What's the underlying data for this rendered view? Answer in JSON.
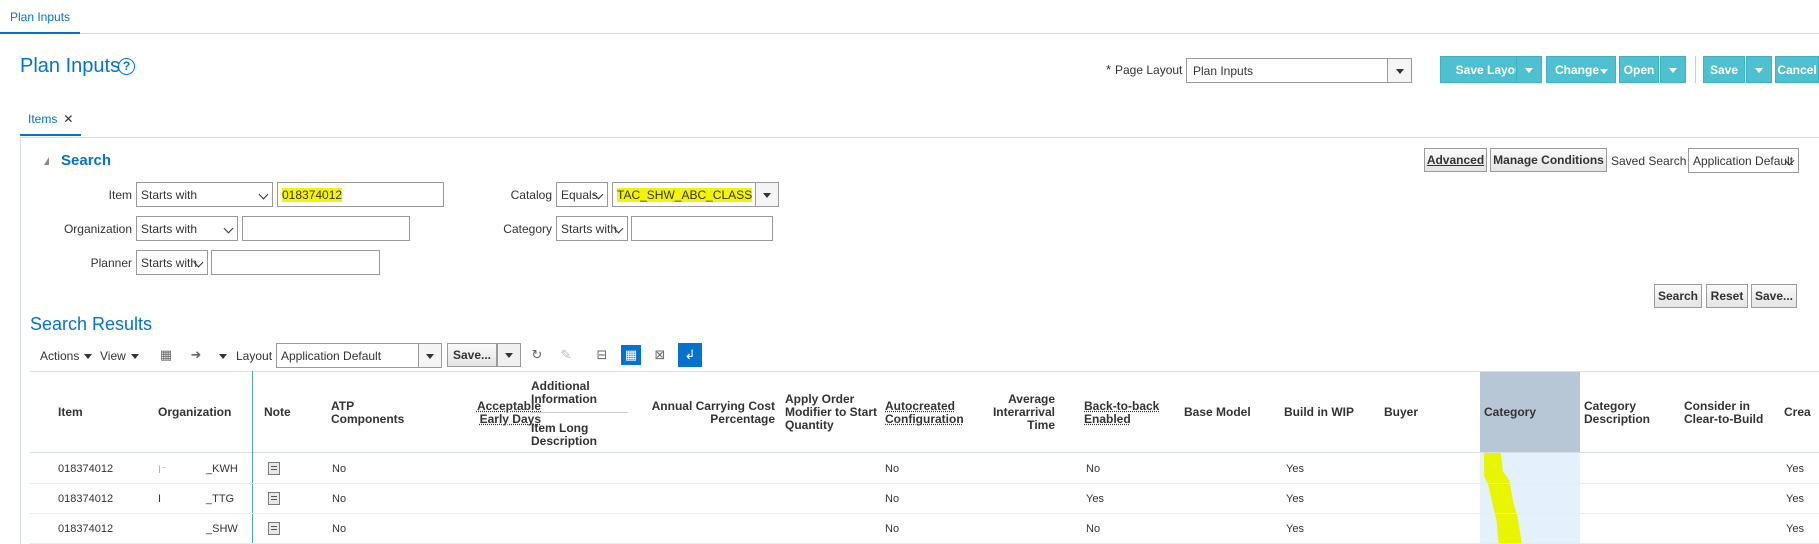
{
  "nav": {
    "tab_label": "Plan Inputs"
  },
  "header": {
    "title": "Plan Inputs",
    "help_icon": "?",
    "page_layout_required": "*",
    "page_layout_label": "Page Layout",
    "page_layout_value": "Plan Inputs",
    "buttons": {
      "save_layout": "Save Layout",
      "change": "Change",
      "open": "Open",
      "save": "Save",
      "cancel": "Cancel"
    }
  },
  "tabs": {
    "items": "Items",
    "close": "✕"
  },
  "search": {
    "heading": "Search",
    "advanced": "Advanced",
    "manage_conditions": "Manage Conditions",
    "saved_search_label": "Saved Search",
    "saved_search_value": "Application Default",
    "item_label": "Item",
    "item_operator": "Starts with",
    "item_value": "018374012",
    "organization_label": "Organization",
    "organization_operator": "Starts with",
    "organization_value": "",
    "planner_label": "Planner",
    "planner_operator": "Starts with",
    "planner_value": "",
    "catalog_label": "Catalog",
    "catalog_operator": "Equals",
    "catalog_value": "TAC_SHW_ABC_CLASS",
    "category_label": "Category",
    "category_operator": "Starts with",
    "category_value": "",
    "search_btn": "Search",
    "reset_btn": "Reset",
    "save_btn": "Save..."
  },
  "results": {
    "heading": "Search Results",
    "actions": "Actions",
    "view": "View",
    "layout_label": "Layout",
    "layout_value": "Application Default",
    "save_btn": "Save..."
  },
  "table": {
    "headers": {
      "item": "Item",
      "organization": "Organization",
      "note": "Note",
      "atp_1": "ATP",
      "atp_2": "Components",
      "acc_1": "Acceptable",
      "acc_2": "Early Days",
      "addl_1": "Additional",
      "addl_2": "Information",
      "ild_1": "Item Long",
      "ild_2": "Description",
      "acc_cost_1": "Annual Carrying Cost",
      "acc_cost_2": "Percentage",
      "aom_1": "Apply Order",
      "aom_2": "Modifier to Start",
      "aom_3": "Quantity",
      "auto_1": "Autocreated",
      "auto_2": "Configuration",
      "ait_1": "Average",
      "ait_2": "Interarrival",
      "ait_3": "Time",
      "b2b_1": "Back-to-back",
      "b2b_2": "Enabled",
      "base_model": "Base Model",
      "build_wip": "Build in WIP",
      "buyer": "Buyer",
      "category": "Category",
      "catdesc_1": "Category",
      "catdesc_2": "Description",
      "ctb_1": "Consider in",
      "ctb_2": "Clear-to-Build",
      "crea": "Crea"
    },
    "rows": [
      {
        "item": "018374012",
        "org_prefix": "I⁻",
        "org_suffix": "_KWH",
        "atp": "No",
        "autocreated": "No",
        "b2b": "No",
        "build_wip": "Yes",
        "crea": "Yes"
      },
      {
        "item": "018374012",
        "org_prefix": "I",
        "org_suffix": "_TTG",
        "atp": "No",
        "autocreated": "No",
        "b2b": "Yes",
        "build_wip": "Yes",
        "crea": "Yes"
      },
      {
        "item": "018374012",
        "org_prefix": "",
        "org_suffix": "_SHW",
        "atp": "No",
        "autocreated": "No",
        "b2b": "No",
        "build_wip": "Yes",
        "crea": "Yes"
      }
    ]
  },
  "colors": {
    "accent": "#0572ce",
    "button": "#4fc0d0",
    "highlight": "#f4f400"
  }
}
